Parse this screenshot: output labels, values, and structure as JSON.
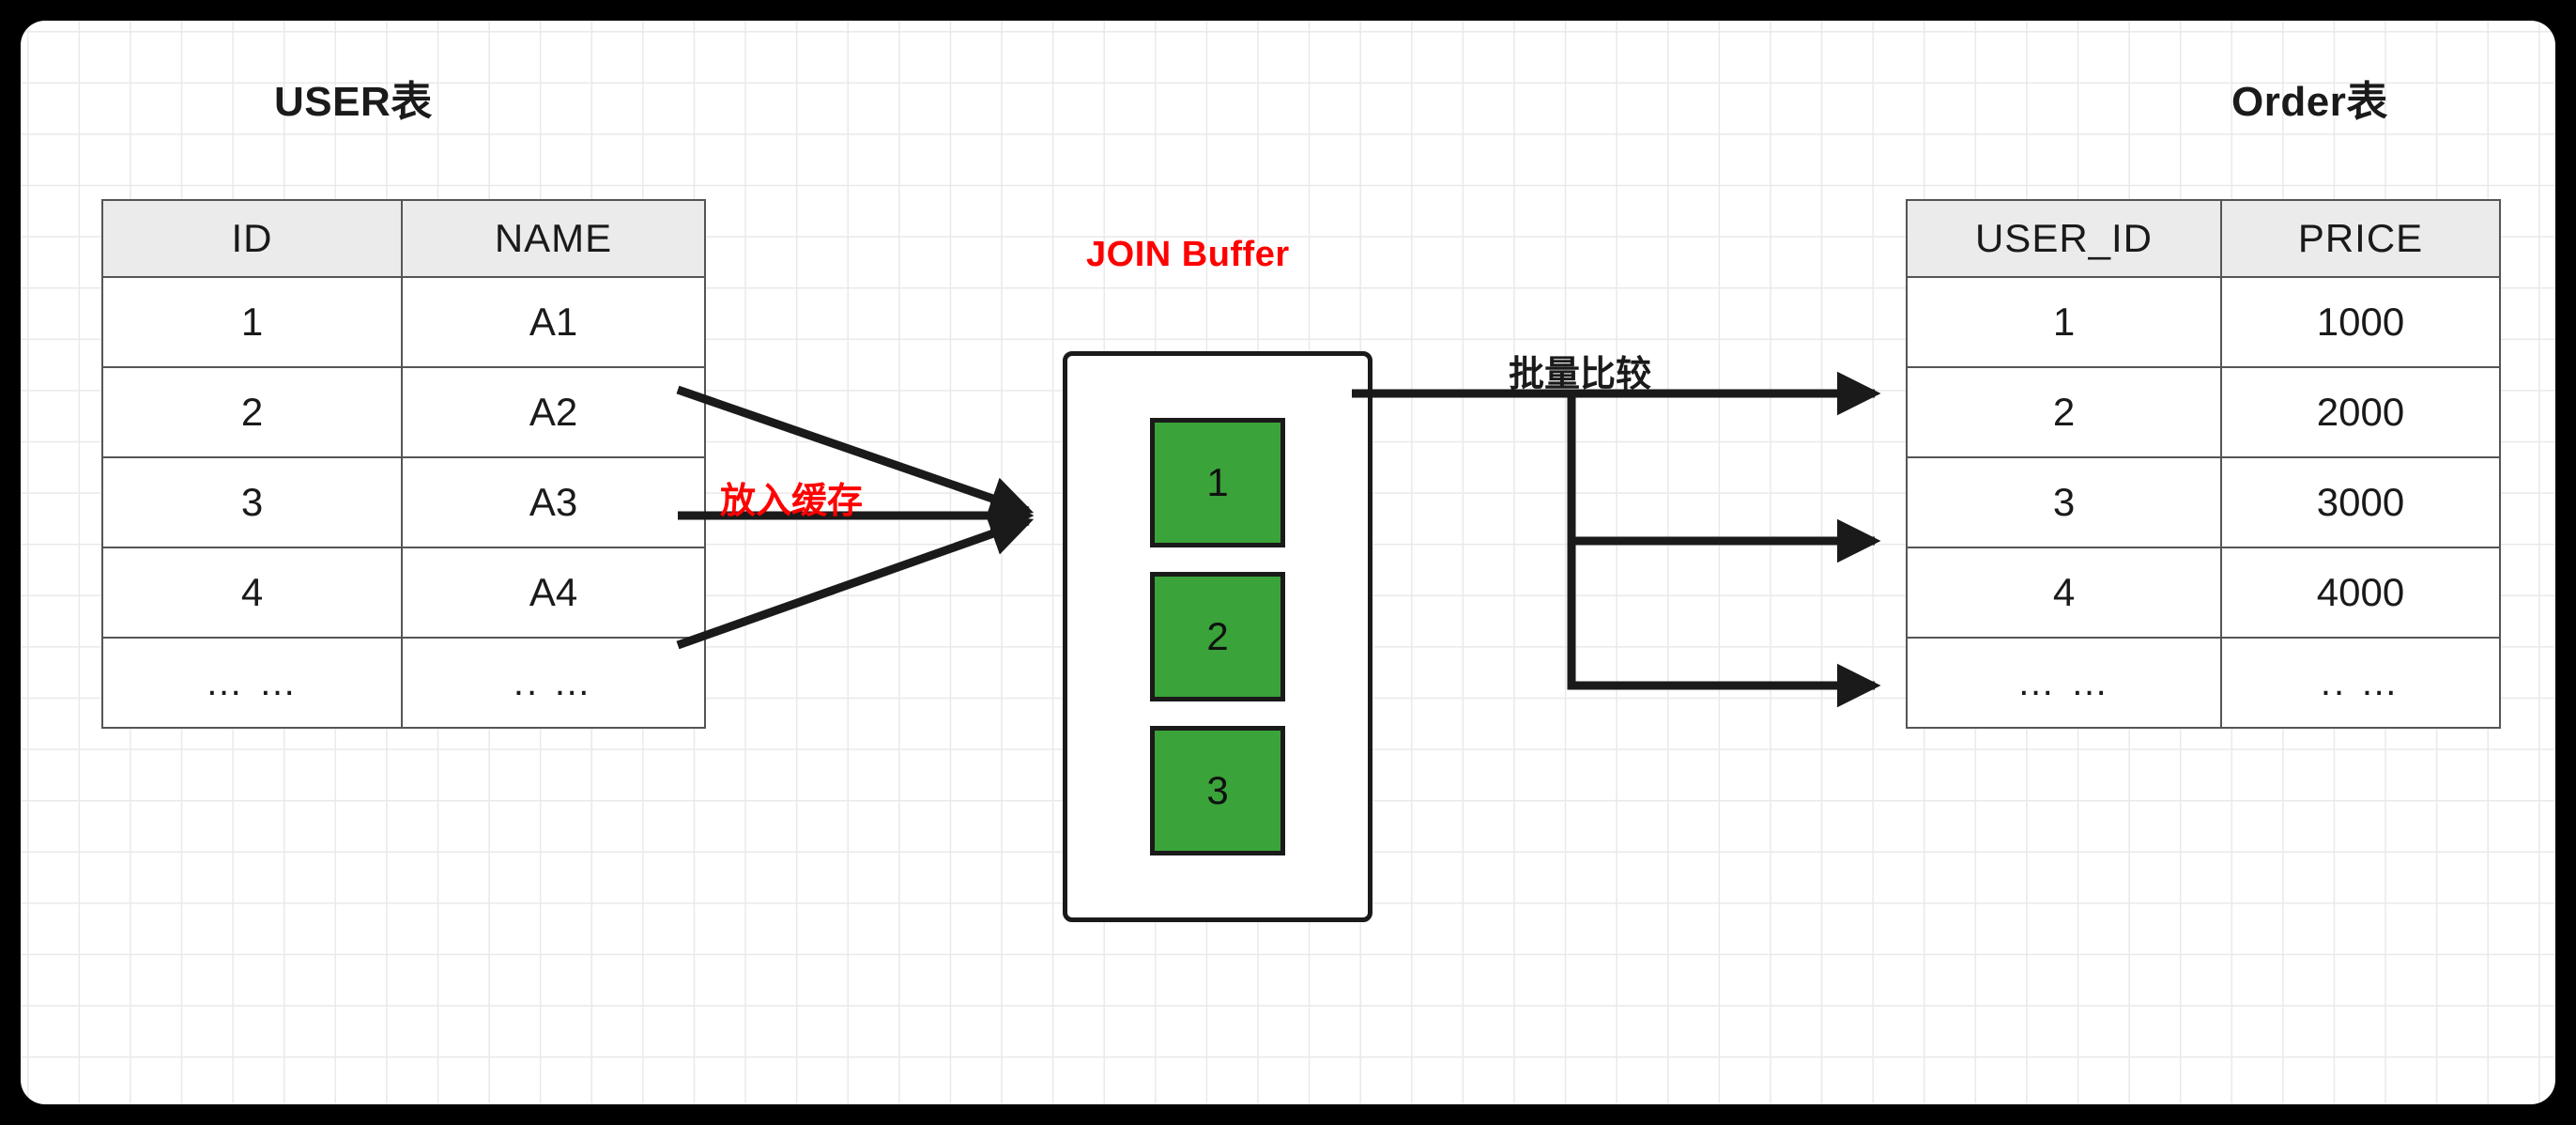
{
  "titles": {
    "user_table": "USER表",
    "order_table": "Order表",
    "join_buffer": "JOIN Buffer"
  },
  "annotations": {
    "put_into_cache": "放入缓存",
    "batch_compare": "批量比较"
  },
  "colors": {
    "accent_red": "#ff0000",
    "buffer_green": "#3aa339",
    "stroke_black": "#1a1a1a",
    "table_header_bg": "#ebebeb",
    "table_border": "#555555",
    "grid_line": "#e9e9e9",
    "page_background": "#000000",
    "paper_background": "#ffffff"
  },
  "user_table": {
    "headers": [
      "ID",
      "NAME"
    ],
    "rows": [
      [
        "1",
        "A1"
      ],
      [
        "2",
        "A2"
      ],
      [
        "3",
        "A3"
      ],
      [
        "4",
        "A4"
      ],
      [
        "… …",
        ".. …"
      ]
    ]
  },
  "order_table": {
    "headers": [
      "USER_ID",
      "PRICE"
    ],
    "rows": [
      [
        "1",
        "1000"
      ],
      [
        "2",
        "2000"
      ],
      [
        "3",
        "3000"
      ],
      [
        "4",
        "4000"
      ],
      [
        "… …",
        ".. …"
      ]
    ]
  },
  "join_buffer": {
    "slots": [
      "1",
      "2",
      "3"
    ]
  }
}
